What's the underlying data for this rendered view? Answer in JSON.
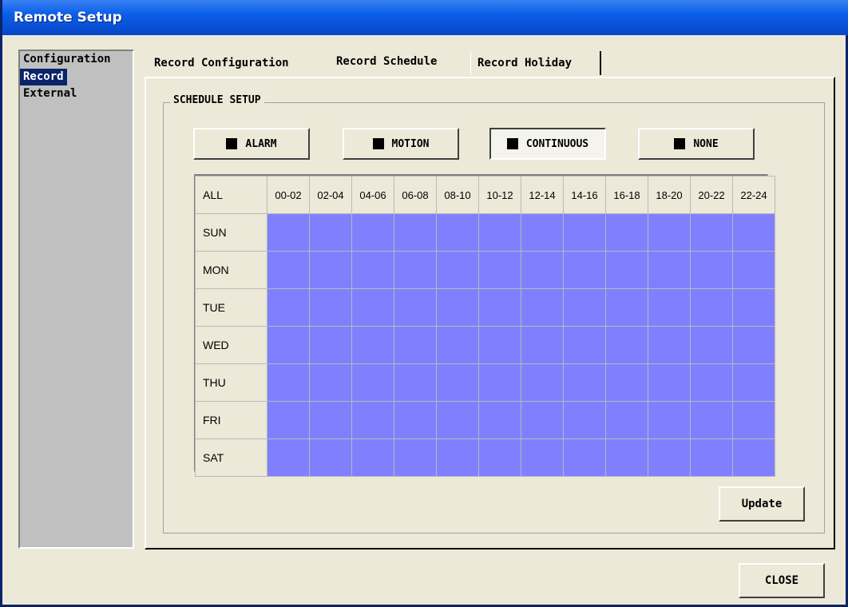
{
  "window": {
    "title": "Remote Setup"
  },
  "sidebar": {
    "items": [
      {
        "label": "Configuration"
      },
      {
        "label": "Record",
        "selected": true
      },
      {
        "label": "External"
      }
    ]
  },
  "tabs": [
    {
      "label": "Record Configuration"
    },
    {
      "label": "Record Schedule",
      "active": true
    },
    {
      "label": "Record Holiday"
    }
  ],
  "schedule": {
    "group_title": "SCHEDULE SETUP",
    "modes": [
      {
        "label": "ALARM"
      },
      {
        "label": "MOTION"
      },
      {
        "label": "CONTINUOUS",
        "selected": true
      },
      {
        "label": "NONE"
      }
    ],
    "all_label": "ALL",
    "columns": [
      "00-02",
      "02-04",
      "04-06",
      "06-08",
      "08-10",
      "10-12",
      "12-14",
      "14-16",
      "16-18",
      "18-20",
      "20-22",
      "22-24"
    ],
    "days": [
      "SUN",
      "MON",
      "TUE",
      "WED",
      "THU",
      "FRI",
      "SAT"
    ],
    "cell_mode": "CONTINUOUS",
    "cell_color": "#8080ff"
  },
  "buttons": {
    "update": "Update",
    "close": "CLOSE"
  }
}
